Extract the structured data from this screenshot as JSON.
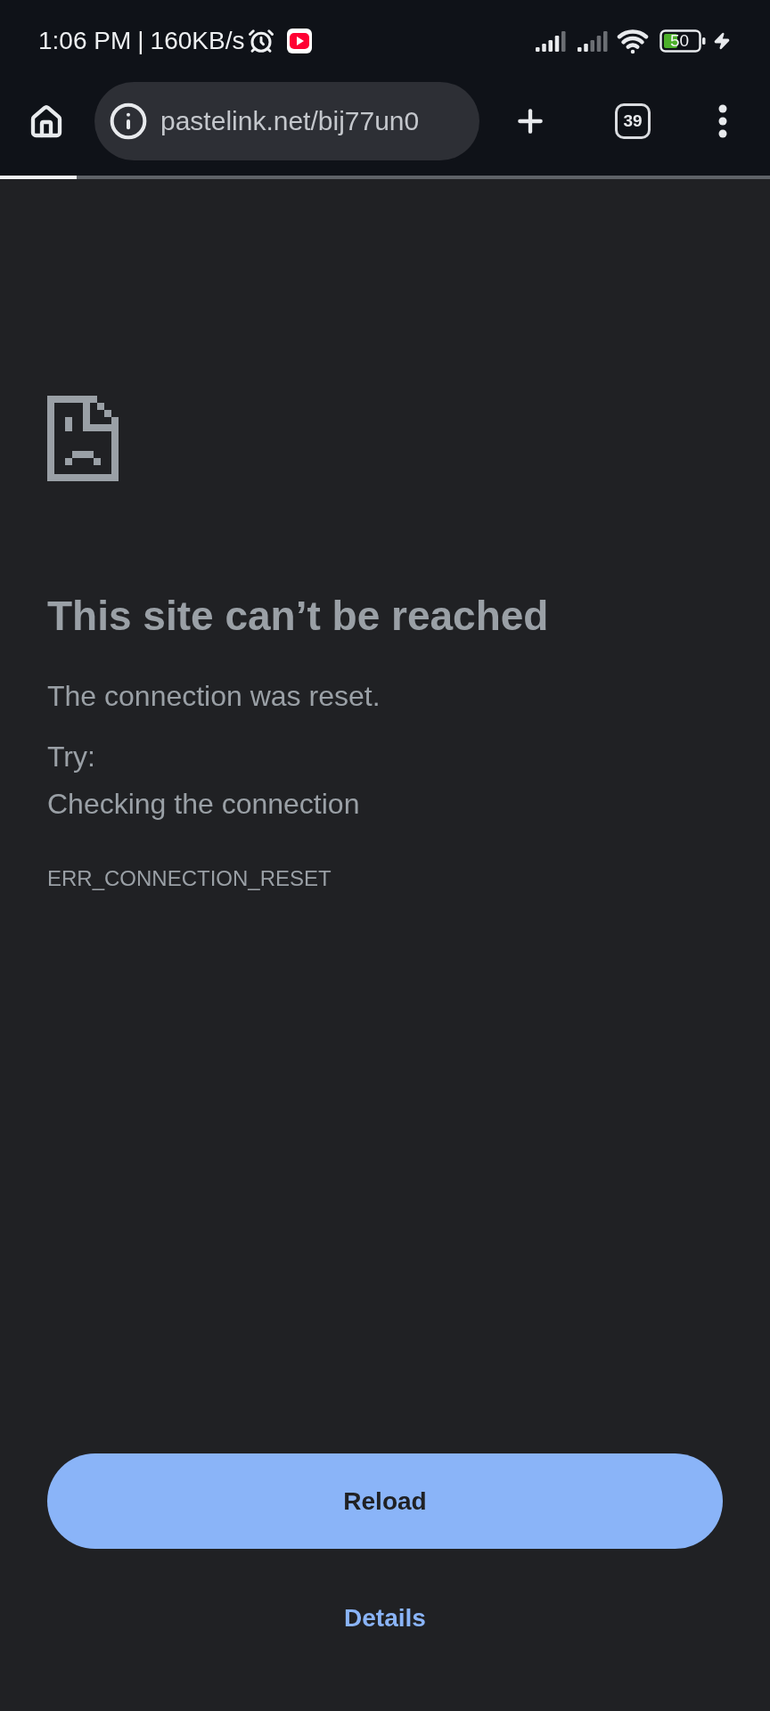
{
  "status_bar": {
    "time": "1:06 PM",
    "separator": "|",
    "network_speed": "160KB/s",
    "battery": "50"
  },
  "toolbar": {
    "url": "pastelink.net/bij77un0",
    "tab_count": "39"
  },
  "page_load": {
    "level": 0.1
  },
  "error": {
    "title": "This site can’t be reached",
    "message": "The connection was reset.",
    "try_label": "Try:",
    "suggestions": [
      "Checking the connection"
    ],
    "code": "ERR_CONNECTION_RESET"
  },
  "buttons": {
    "primary": "Reload",
    "secondary": "Details"
  }
}
